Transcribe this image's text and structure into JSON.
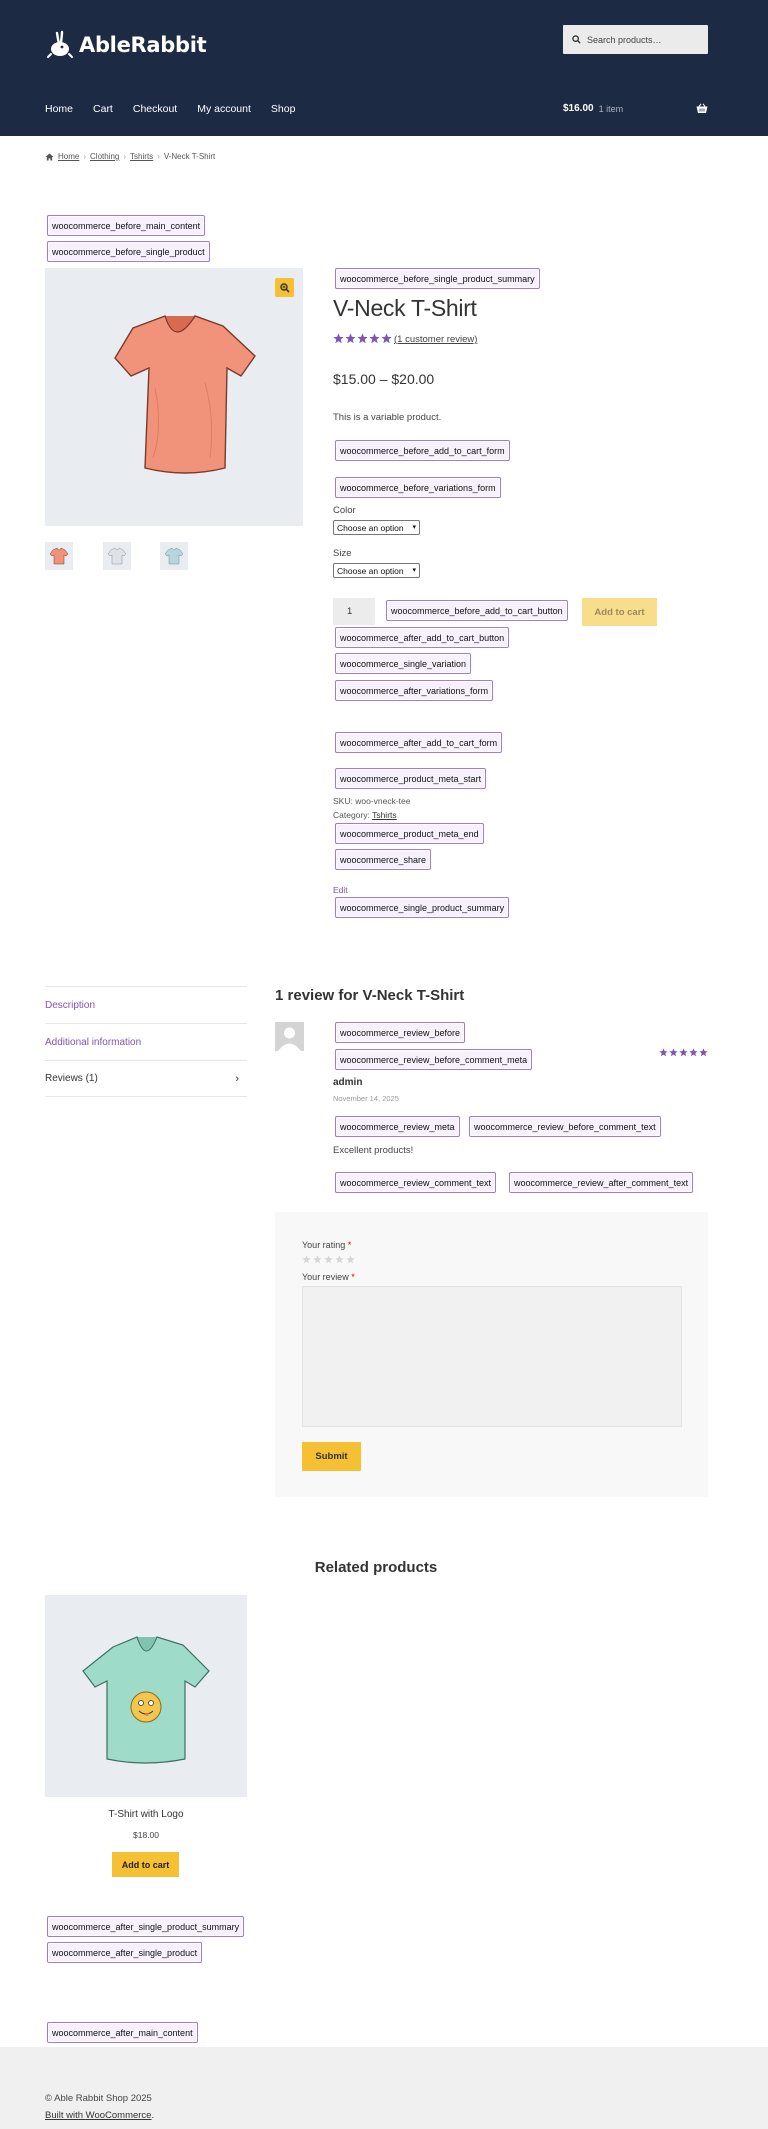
{
  "header": {
    "brand": "AbleRabbit",
    "search_placeholder": "Search products…",
    "nav": [
      "Home",
      "Cart",
      "Checkout",
      "My account",
      "Shop"
    ],
    "cart_total": "$16.00",
    "cart_count": "1 item"
  },
  "breadcrumb": [
    "Home",
    "Clothing",
    "Tshirts",
    "V-Neck T-Shirt"
  ],
  "hooks": {
    "before_main_content": "woocommerce_before_main_content",
    "before_single_product": "woocommerce_before_single_product",
    "before_single_product_summary": "woocommerce_before_single_product_summary",
    "before_add_to_cart_form": "woocommerce_before_add_to_cart_form",
    "before_variations_form": "woocommerce_before_variations_form",
    "before_add_to_cart_button": "woocommerce_before_add_to_cart_button",
    "after_add_to_cart_button": "woocommerce_after_add_to_cart_button",
    "single_variation": "woocommerce_single_variation",
    "after_variations_form": "woocommerce_after_variations_form",
    "after_add_to_cart_form": "woocommerce_after_add_to_cart_form",
    "product_meta_start": "woocommerce_product_meta_start",
    "product_meta_end": "woocommerce_product_meta_end",
    "share": "woocommerce_share",
    "single_product_summary": "woocommerce_single_product_summary",
    "review_before": "woocommerce_review_before",
    "review_before_comment_meta": "woocommerce_review_before_comment_meta",
    "review_meta": "woocommerce_review_meta",
    "review_before_comment_text": "woocommerce_review_before_comment_text",
    "review_comment_text": "woocommerce_review_comment_text",
    "review_after_comment_text": "woocommerce_review_after_comment_text",
    "after_single_product_summary": "woocommerce_after_single_product_summary",
    "after_single_product": "woocommerce_after_single_product",
    "after_main_content": "woocommerce_after_main_content"
  },
  "product": {
    "title": "V-Neck T-Shirt",
    "rating": 5,
    "review_link": "(1 customer review)",
    "price": "$15.00 – $20.00",
    "short_description": "This is a variable product.",
    "attributes": [
      {
        "label": "Color",
        "selected": "Choose an option"
      },
      {
        "label": "Size",
        "selected": "Choose an option"
      }
    ],
    "quantity": "1",
    "add_to_cart": "Add to cart",
    "sku_label": "SKU:",
    "sku": "woo-vneck-tee",
    "category_label": "Category:",
    "category": "Tshirts",
    "edit": "Edit",
    "image_color": "#f0937a",
    "thumb_colors": [
      "#f0937a",
      "#dfe3e8",
      "#b9d4dc"
    ]
  },
  "tabs": [
    {
      "label": "Description"
    },
    {
      "label": "Additional information"
    },
    {
      "label": "Reviews (1)"
    }
  ],
  "reviews": {
    "title": "1 review for V-Neck T-Shirt",
    "author": "admin",
    "date": "November 14, 2025",
    "text": "Excellent products!",
    "rating": 5
  },
  "review_form": {
    "rating_label": "Your rating",
    "review_label": "Your review",
    "required_mark": "*",
    "submit": "Submit"
  },
  "related": {
    "title": "Related products",
    "name": "T-Shirt with Logo",
    "price": "$18.00",
    "button": "Add to cart",
    "image_color": "#9edcc9"
  },
  "footer": {
    "copyright": "© Able Rabbit Shop 2025",
    "built_prefix": "Built with ",
    "built_link": "WooCommerce",
    "built_suffix": "."
  },
  "colors": {
    "header_bg": "#1c2a43",
    "accent_purple": "#7f54b3",
    "button_yellow": "#f5c033",
    "star_purple": "#7f54b3"
  }
}
